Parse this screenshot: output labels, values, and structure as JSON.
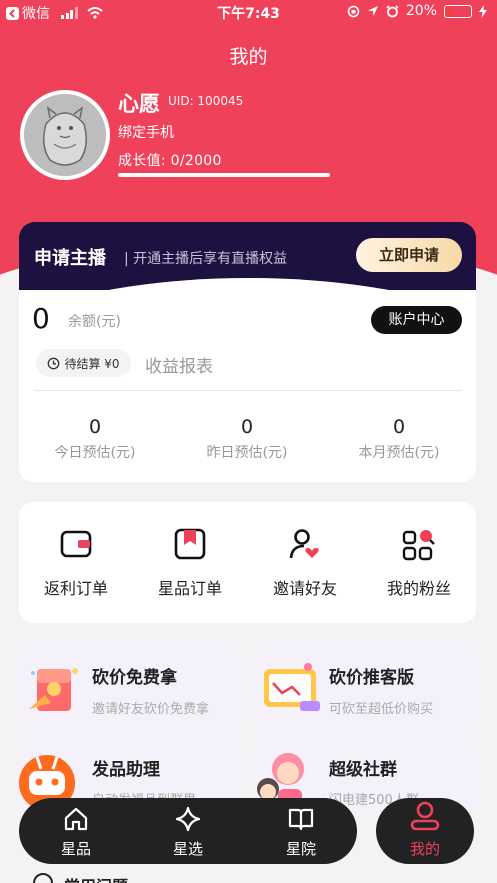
{
  "status_bar": {
    "carrier": "微信",
    "time": "下午7:43",
    "battery": "20%"
  },
  "header": {
    "title": "我的"
  },
  "profile": {
    "nickname": "心愿",
    "uid": "UID: 100045",
    "bind_phone": "绑定手机",
    "growth": "成长值: 0/2000"
  },
  "anchor_banner": {
    "title": "申请主播",
    "subtitle": "| 开通主播后享有直播权益",
    "button": "立即申请"
  },
  "wallet": {
    "balance": "0",
    "balance_label": "余额(元)",
    "account_center": "账户中心",
    "pending": "待结算 ¥0",
    "report": "收益报表",
    "stats": [
      {
        "value": "0",
        "label": "今日预估(元)"
      },
      {
        "value": "0",
        "label": "昨日预估(元)"
      },
      {
        "value": "0",
        "label": "本月预估(元)"
      }
    ]
  },
  "quick_actions": [
    {
      "label": "返利订单",
      "icon": "wallet-icon"
    },
    {
      "label": "星品订单",
      "icon": "bookmark-icon"
    },
    {
      "label": "邀请好友",
      "icon": "invite-user-icon"
    },
    {
      "label": "我的粉丝",
      "icon": "fans-grid-icon"
    }
  ],
  "promos": [
    {
      "title": "砍价免费拿",
      "subtitle": "邀请好友砍价免费拿"
    },
    {
      "title": "砍价推客版",
      "subtitle": "可砍至超低价购买"
    },
    {
      "title": "发品助理",
      "subtitle": "自动发福品到群里"
    },
    {
      "title": "超级社群",
      "subtitle": "闪电建500人群"
    }
  ],
  "bottom_nav": {
    "items": [
      {
        "label": "星品"
      },
      {
        "label": "星选"
      },
      {
        "label": "星院"
      }
    ],
    "active": "我的"
  },
  "section_partial": "常用问题",
  "colors": {
    "brand": "#f0415a",
    "dark": "#1c1140",
    "nav": "#222222"
  }
}
